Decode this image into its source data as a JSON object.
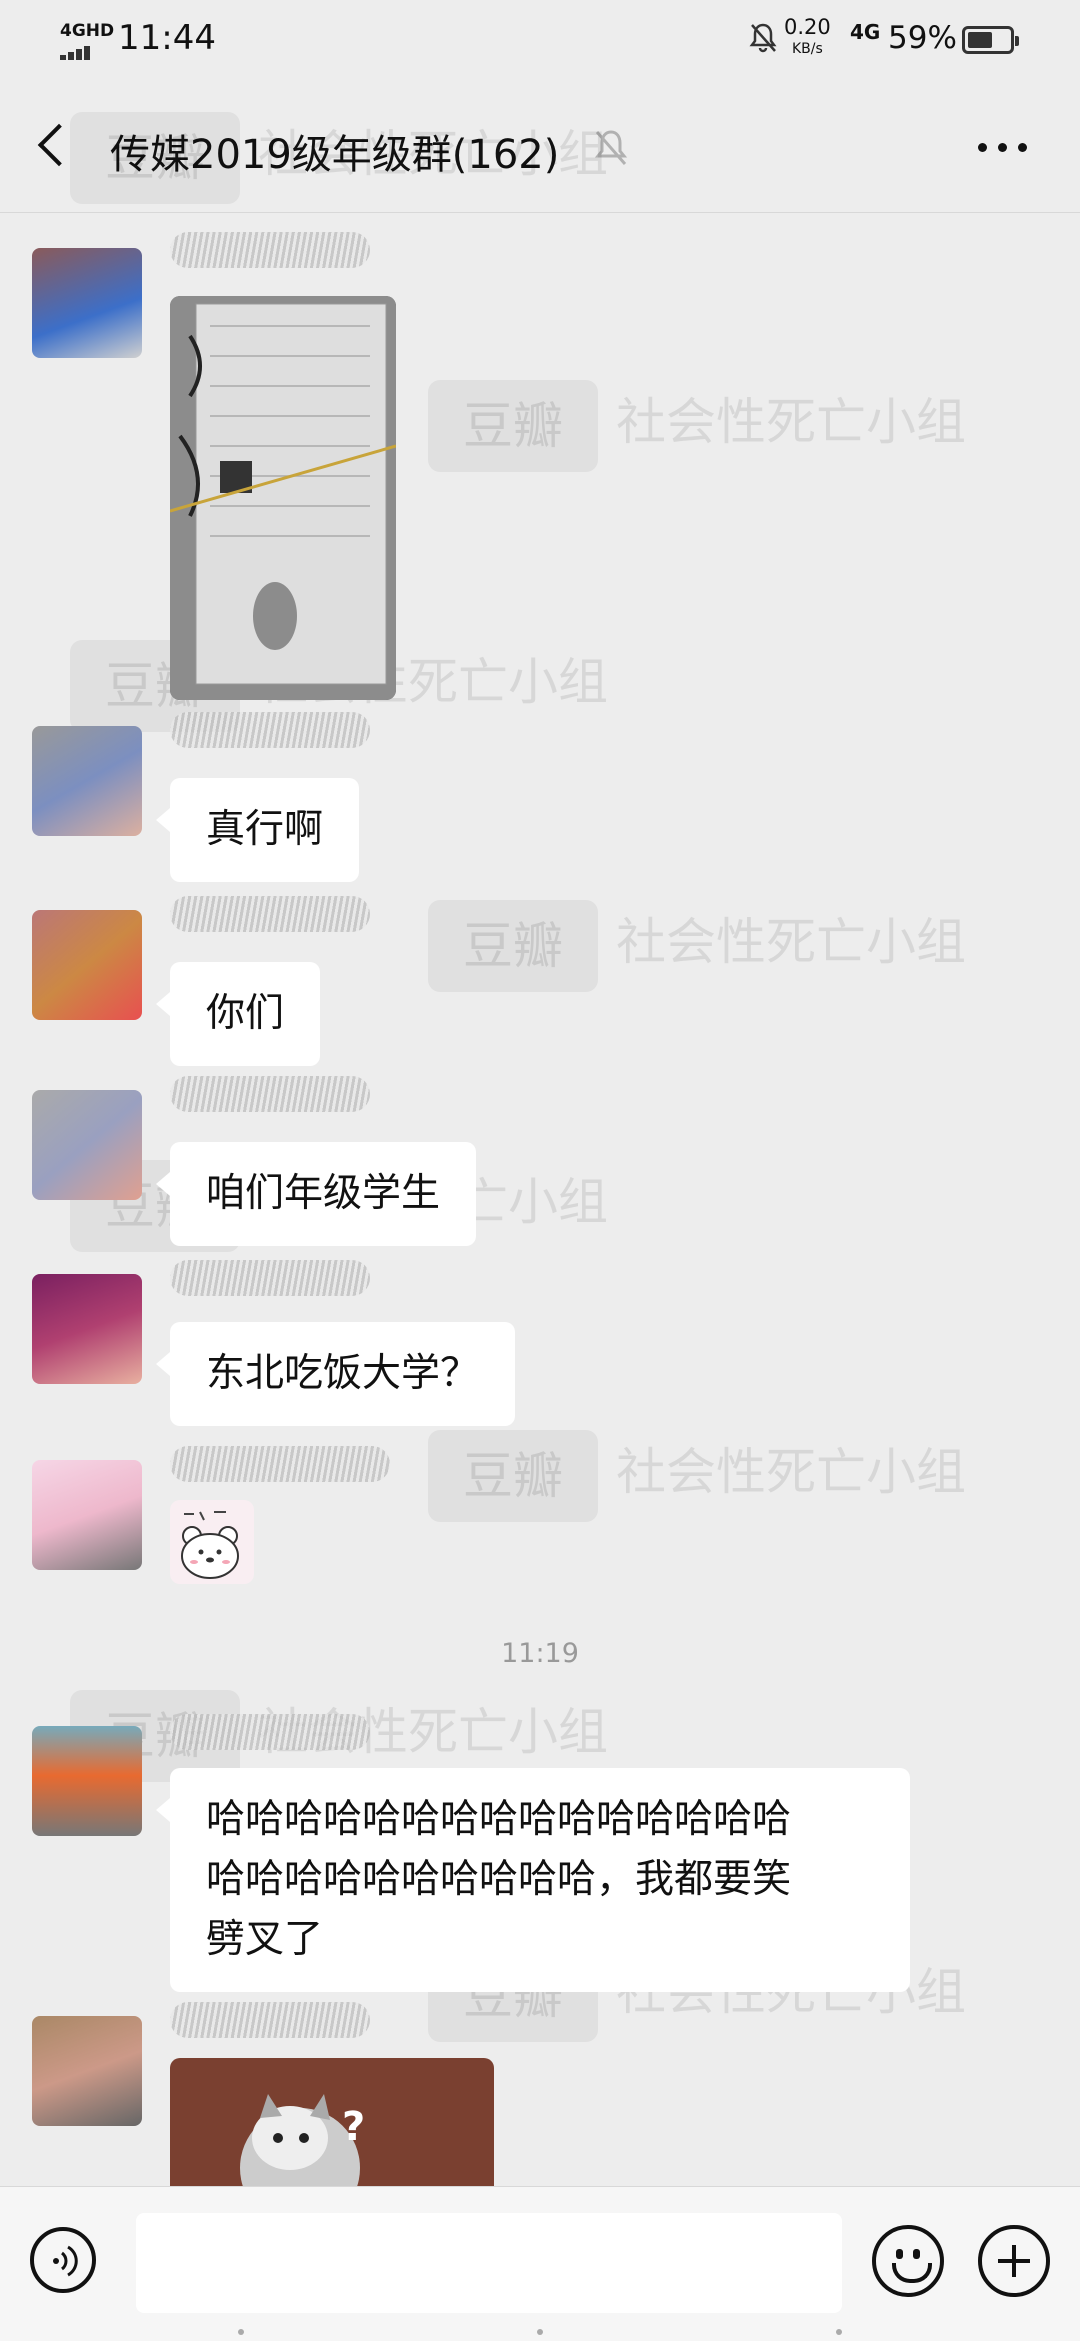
{
  "status_bar": {
    "network_type": "4GHD",
    "time": "11:44",
    "speed_value": "0.20",
    "speed_unit": "KB/s",
    "mobile_data": "4G",
    "battery_percent": "59%",
    "battery_level": 0.59
  },
  "header": {
    "title": "传媒2019级年级群(162)",
    "back_icon": "chevron-left-icon",
    "mute_icon": "bell-muted-icon",
    "more_icon": "more-dots-icon"
  },
  "messages": [
    {
      "type": "image",
      "content": "exam admission ticket photo"
    },
    {
      "type": "text",
      "text": "真行啊"
    },
    {
      "type": "text",
      "text": "你们"
    },
    {
      "type": "text",
      "text": "咱们年级学生"
    },
    {
      "type": "text",
      "text": "东北吃饭大学？"
    },
    {
      "type": "sticker",
      "content": "bear sticker"
    },
    {
      "type": "timestamp",
      "text": "11:19"
    },
    {
      "type": "text",
      "text_lines": [
        "哈哈哈哈哈哈哈哈哈哈哈哈哈哈哈",
        "哈哈哈哈哈哈哈哈哈哈，我都要笑",
        "劈叉了"
      ]
    },
    {
      "type": "image",
      "content": "cat with question mark"
    }
  ],
  "watermark": {
    "logo_text": "豆瓣",
    "group_text": "社会性死亡小组"
  },
  "input_bar": {
    "voice_icon": "voice-icon",
    "emoji_icon": "emoji-icon",
    "plus_icon": "plus-icon"
  },
  "colors": {
    "background": "#ededed",
    "bubble": "#ffffff",
    "text": "#111111"
  }
}
